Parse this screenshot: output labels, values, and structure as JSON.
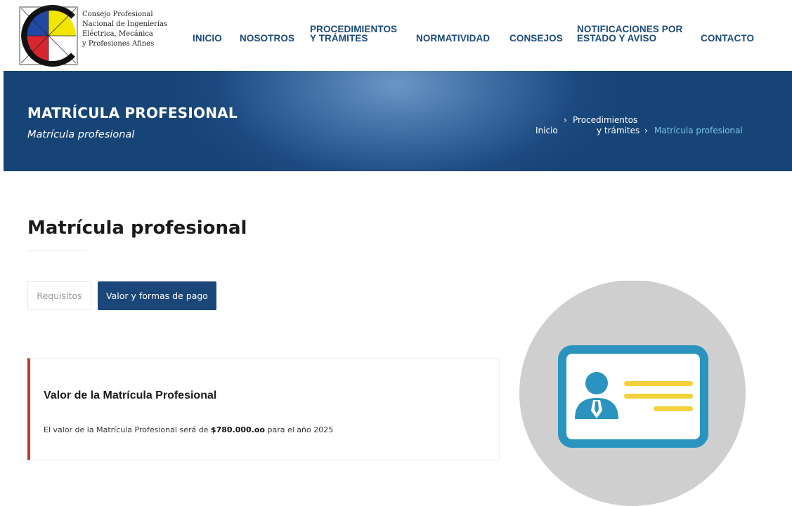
{
  "logo": {
    "lines": [
      "Consejo Profesional",
      "Nacional de Ingenierías",
      "Eléctrica, Mecánica",
      "y Profesiones Afines"
    ],
    "colors": [
      "#f2e600",
      "#2148a6",
      "#d8262e",
      "#ffffff"
    ]
  },
  "nav": {
    "inicio": "INICIO",
    "nosotros": "NOSOTROS",
    "procedimientos_1": "PROCEDIMIENTOS",
    "procedimientos_2": "Y TRÁMITES",
    "normatividad": "NORMATIVIDAD",
    "consejos": "CONSEJOS",
    "notificaciones_1": "NOTIFICACIONES POR",
    "notificaciones_2": "ESTADO Y AVISO",
    "contacto": "CONTACTO"
  },
  "banner": {
    "title": "MATRÍCULA PROFESIONAL",
    "subtitle": "Matrícula profesional"
  },
  "breadcrumb": {
    "home": "Inicio",
    "separator": "›",
    "section_1": "Procedimientos",
    "section_2": "y trámites",
    "current": "Matrícula profesional"
  },
  "main": {
    "title": "Matrícula profesional",
    "tabs": [
      {
        "label": "Requisitos",
        "active": false
      },
      {
        "label": "Valor y formas de pago",
        "active": true
      }
    ]
  },
  "card": {
    "title": "Valor de la Matrícula Profesional",
    "text_before": "El valor de la Matrícula Profesional será de ",
    "amount": "$780.000.oo",
    "text_after": " para el año 2025"
  },
  "illustration": {
    "icon": "id-card-icon",
    "colors": {
      "circle": "#cfcfcf",
      "card_border": "#2a93bf",
      "person": "#2a93bf",
      "lines": "#f2d13a"
    }
  },
  "colors": {
    "nav_text": "#1a4a7a",
    "banner": "#1c4a80",
    "tab_active": "#1b4679",
    "card_accent": "#c0392b",
    "breadcrumb_active": "#7cc4e6"
  }
}
